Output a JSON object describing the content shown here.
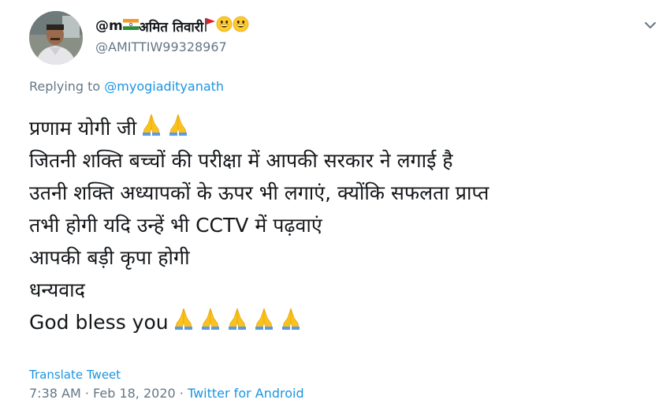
{
  "author": {
    "name_prefix": "@m",
    "name_hindi": " अमित तिवारी ",
    "handle": "@AMITTIW99328967"
  },
  "reply": {
    "label": "Replying to ",
    "target": "@myogiadityanath"
  },
  "tweet": {
    "lines": [
      "प्रणाम योगी जी ",
      "जितनी शक्ति बच्चों की परीक्षा में आपकी सरकार ने लगाई है",
      "उतनी शक्ति अध्यापकों के ऊपर भी लगाएं, क्योंकि सफलता प्राप्त",
      "तभी होगी यदि उन्हें भी CCTV में पढ़वाएं",
      "आपकी बड़ी कृपा होगी",
      "धन्यवाद",
      "God bless you "
    ]
  },
  "translate_label": "Translate Tweet",
  "meta": {
    "time": "7:38 AM",
    "sep1": " · ",
    "date": "Feb 18, 2020",
    "sep2": " · ",
    "source": "Twitter for Android"
  },
  "icons": {
    "flag": "india-flag-icon",
    "pennant": "red-pennant-icon",
    "smiley": "grinning-face-icon",
    "pray": "folded-hands-icon",
    "caret": "chevron-down-icon"
  },
  "colors": {
    "link": "#1b95e0",
    "muted": "#657786",
    "text": "#14171a"
  }
}
